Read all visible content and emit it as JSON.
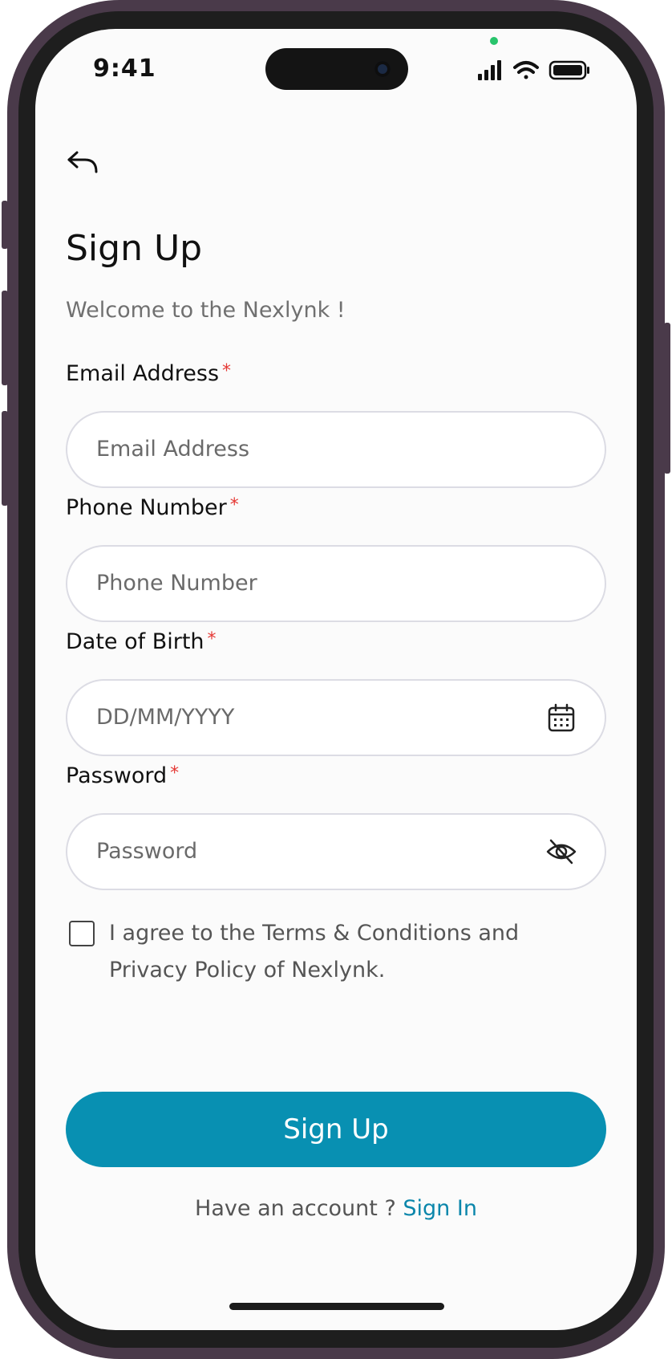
{
  "status_bar": {
    "time": "9:41"
  },
  "header": {
    "back_icon": "back-arrow-icon"
  },
  "page": {
    "title": "Sign Up",
    "subtitle": "Welcome to the Nexlynk !"
  },
  "form": {
    "email": {
      "label": "Email Address",
      "required": "*",
      "placeholder": "Email Address"
    },
    "phone": {
      "label": "Phone Number",
      "required": "*",
      "placeholder": "Phone Number"
    },
    "dob": {
      "label": "Date of Birth",
      "required": "*",
      "placeholder": "DD/MM/YYYY",
      "icon": "calendar-icon"
    },
    "password": {
      "label": "Password",
      "required": "*",
      "placeholder": "Password",
      "icon": "eye-off-icon"
    },
    "agree": {
      "text": "I agree to the Terms & Conditions and Privacy Policy of Nexlynk.",
      "checked": false
    },
    "submit_label": "Sign Up"
  },
  "footer": {
    "prompt": "Have an account ?",
    "link": "Sign In"
  },
  "colors": {
    "accent": "#0890b2",
    "link": "#0a86ab",
    "required": "#e53935",
    "frame": "#4a3a4a"
  }
}
